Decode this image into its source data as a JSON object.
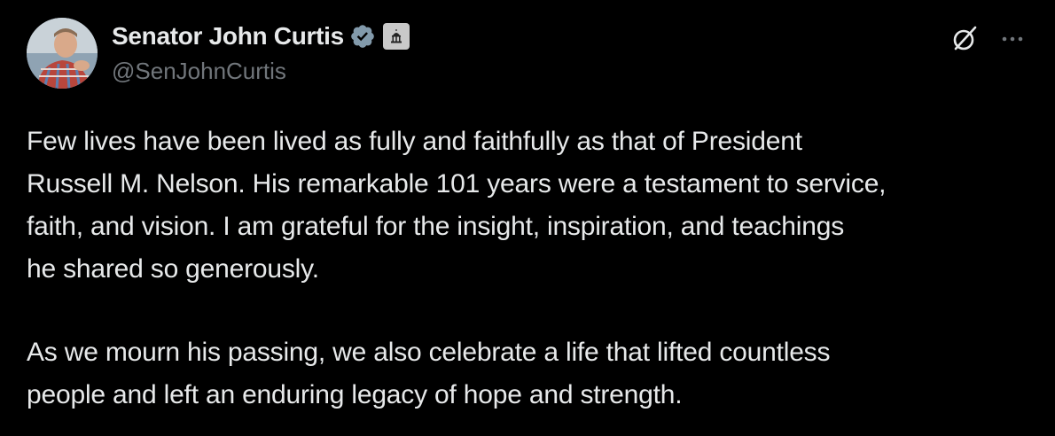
{
  "author": {
    "display_name": "Senator John Curtis",
    "handle": "@SenJohnCurtis",
    "verified_badge_icon": "verified-badge-icon",
    "affiliation_icon": "capitol-building-icon"
  },
  "actions": {
    "grok_icon": "grok-icon",
    "more_icon": "more-dots-icon"
  },
  "tweet": {
    "paragraph_1": "Few lives have been lived as fully and faithfully as that of President\nRussell M. Nelson. His remarkable 101 years were a testament to service,\nfaith, and vision. I am grateful for the insight, inspiration, and teachings\nhe shared so generously.",
    "paragraph_2": "As we mourn his passing, we also celebrate a life that lifted countless\npeople and left an enduring legacy of hope and strength."
  },
  "colors": {
    "background": "#000000",
    "primary_text": "#e7e9ea",
    "secondary_text": "#71767b",
    "verified_badge": "#829aab"
  }
}
